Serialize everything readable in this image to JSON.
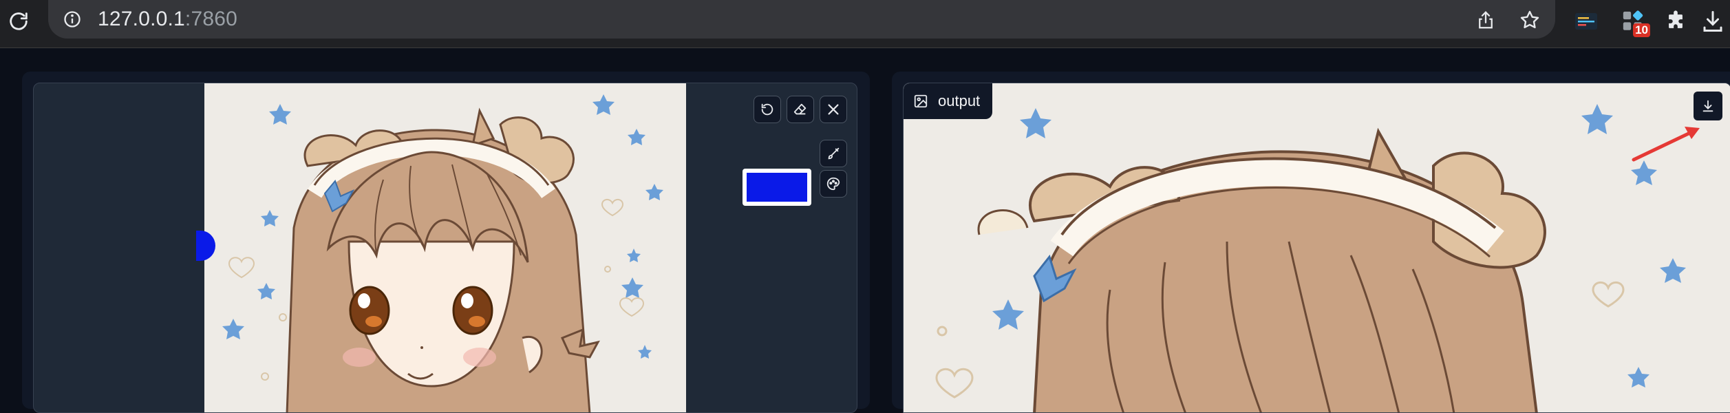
{
  "browser": {
    "url_host": "127.0.0.1",
    "url_port": ":7860",
    "extension_badge": "10"
  },
  "editor": {
    "brush_color": "#0a1ae8"
  },
  "output": {
    "label": "output"
  },
  "colors": {
    "page_bg": "#0b0f19",
    "panel_bg": "#1f2937",
    "annotation_arrow": "#e53935"
  }
}
